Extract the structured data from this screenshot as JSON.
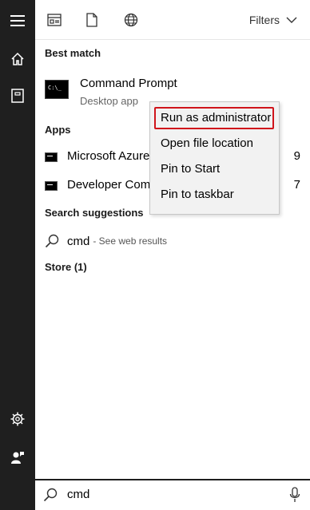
{
  "rail": {
    "items": [
      {
        "icon": "hamburger-menu-icon"
      },
      {
        "icon": "home-icon"
      },
      {
        "icon": "notebook-icon"
      },
      {
        "icon": "settings-gear-icon"
      },
      {
        "icon": "user-feedback-icon"
      }
    ]
  },
  "topbar": {
    "icons": [
      "apps-icon",
      "document-icon",
      "web-globe-icon"
    ],
    "filters_label": "Filters"
  },
  "sections": {
    "best_match": "Best match",
    "apps": "Apps",
    "search_suggestions": "Search suggestions",
    "store": "Store (1)"
  },
  "best_match": {
    "title": "Command Prompt",
    "subtitle": "Desktop app"
  },
  "apps": [
    {
      "label": "Microsoft Azure",
      "trail": "9"
    },
    {
      "label": "Developer Com",
      "trail": "7"
    }
  ],
  "suggestion": {
    "term": "cmd",
    "hint": "- See web results"
  },
  "context_menu": {
    "items": [
      {
        "label": "Run as administrator",
        "highlighted": true
      },
      {
        "label": "Open file location"
      },
      {
        "label": "Pin to Start"
      },
      {
        "label": "Pin to taskbar"
      }
    ],
    "highlight_color": "#d0141b"
  },
  "search": {
    "value": "cmd"
  },
  "colors": {
    "rail_bg": "#1f1f1f",
    "panel_bg": "#ffffff",
    "menu_bg": "#f2f2f2"
  }
}
